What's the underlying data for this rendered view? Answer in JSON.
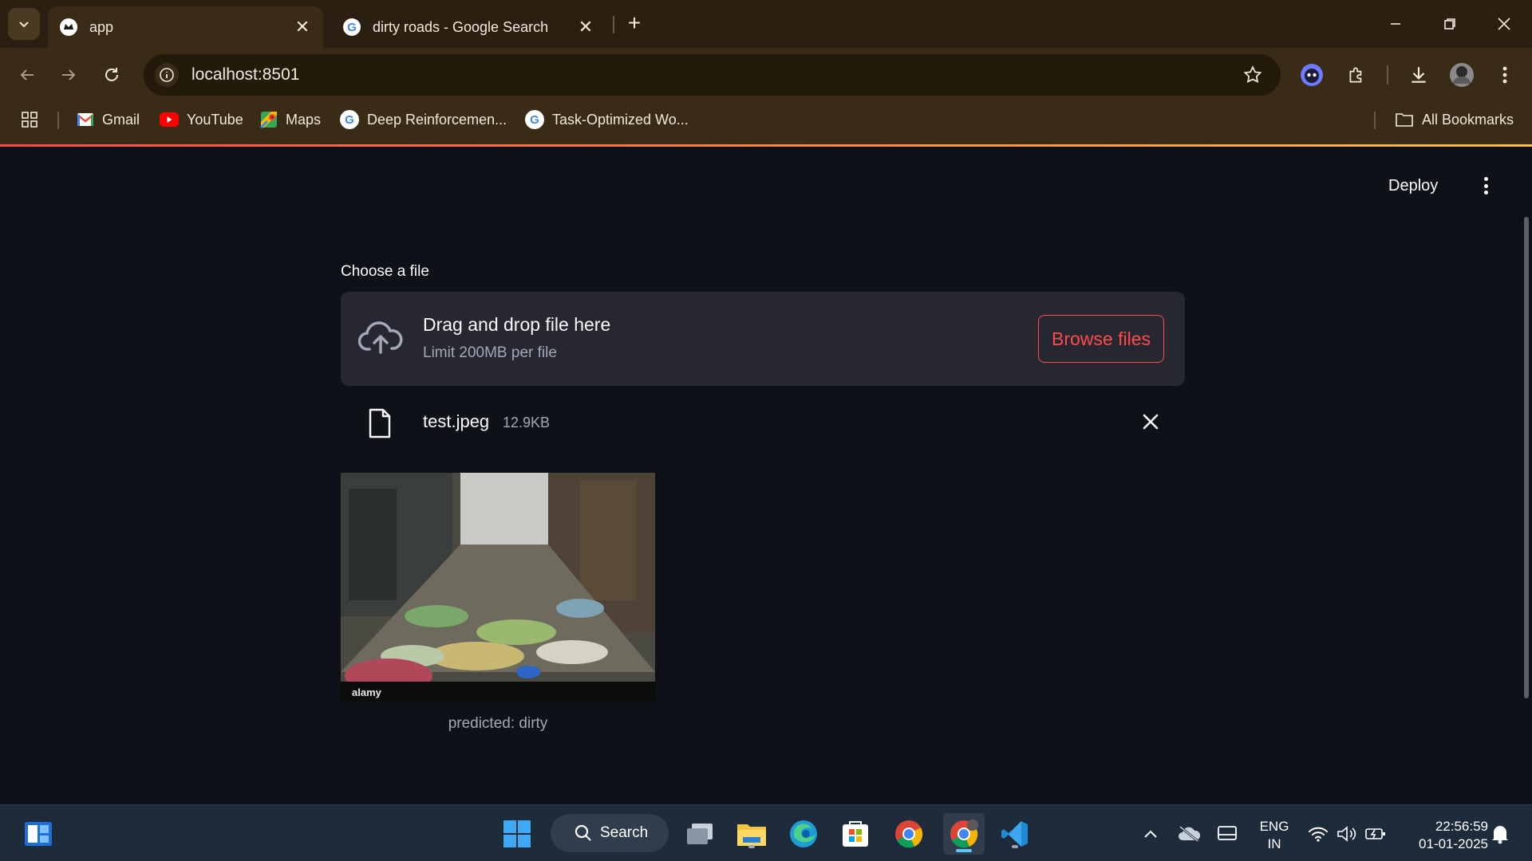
{
  "browser": {
    "tabs": [
      {
        "title": "app",
        "active": true
      },
      {
        "title": "dirty roads - Google Search",
        "active": false
      }
    ],
    "url": "localhost:8501",
    "bookmarks": [
      {
        "label": "Gmail"
      },
      {
        "label": "YouTube"
      },
      {
        "label": "Maps"
      },
      {
        "label": "Deep Reinforcemen..."
      },
      {
        "label": "Task-Optimized Wo..."
      }
    ],
    "all_bookmarks_label": "All Bookmarks",
    "accent_colors": [
      "#ff4b4b",
      "#ffbd45"
    ]
  },
  "app": {
    "deploy_label": "Deploy",
    "uploader": {
      "label": "Choose a file",
      "drop_title": "Drag and drop file here",
      "drop_limit": "Limit 200MB per file",
      "browse_label": "Browse files"
    },
    "file": {
      "name": "test.jpeg",
      "size": "12.9KB"
    },
    "preview": {
      "watermark": "alamy",
      "caption": "predicted: dirty"
    },
    "colors": {
      "primary": "#ff4b4b",
      "background": "#0e1117",
      "secondary_bg": "#262730"
    }
  },
  "taskbar": {
    "search_label": "Search",
    "language": "ENG",
    "region": "IN",
    "time": "22:56:59",
    "date": "01-01-2025"
  }
}
